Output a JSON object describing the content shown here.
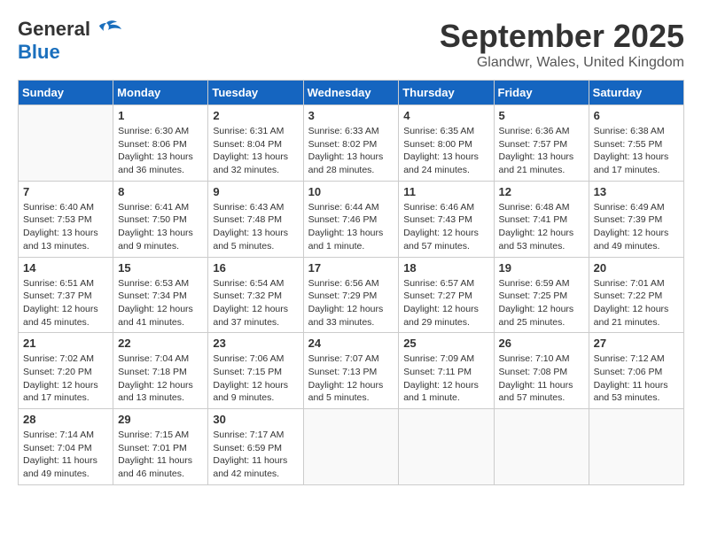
{
  "header": {
    "logo_general": "General",
    "logo_blue": "Blue",
    "month_title": "September 2025",
    "location": "Glandwr, Wales, United Kingdom"
  },
  "weekdays": [
    "Sunday",
    "Monday",
    "Tuesday",
    "Wednesday",
    "Thursday",
    "Friday",
    "Saturday"
  ],
  "weeks": [
    [
      {
        "day": "",
        "info": ""
      },
      {
        "day": "1",
        "info": "Sunrise: 6:30 AM\nSunset: 8:06 PM\nDaylight: 13 hours\nand 36 minutes."
      },
      {
        "day": "2",
        "info": "Sunrise: 6:31 AM\nSunset: 8:04 PM\nDaylight: 13 hours\nand 32 minutes."
      },
      {
        "day": "3",
        "info": "Sunrise: 6:33 AM\nSunset: 8:02 PM\nDaylight: 13 hours\nand 28 minutes."
      },
      {
        "day": "4",
        "info": "Sunrise: 6:35 AM\nSunset: 8:00 PM\nDaylight: 13 hours\nand 24 minutes."
      },
      {
        "day": "5",
        "info": "Sunrise: 6:36 AM\nSunset: 7:57 PM\nDaylight: 13 hours\nand 21 minutes."
      },
      {
        "day": "6",
        "info": "Sunrise: 6:38 AM\nSunset: 7:55 PM\nDaylight: 13 hours\nand 17 minutes."
      }
    ],
    [
      {
        "day": "7",
        "info": "Sunrise: 6:40 AM\nSunset: 7:53 PM\nDaylight: 13 hours\nand 13 minutes."
      },
      {
        "day": "8",
        "info": "Sunrise: 6:41 AM\nSunset: 7:50 PM\nDaylight: 13 hours\nand 9 minutes."
      },
      {
        "day": "9",
        "info": "Sunrise: 6:43 AM\nSunset: 7:48 PM\nDaylight: 13 hours\nand 5 minutes."
      },
      {
        "day": "10",
        "info": "Sunrise: 6:44 AM\nSunset: 7:46 PM\nDaylight: 13 hours\nand 1 minute."
      },
      {
        "day": "11",
        "info": "Sunrise: 6:46 AM\nSunset: 7:43 PM\nDaylight: 12 hours\nand 57 minutes."
      },
      {
        "day": "12",
        "info": "Sunrise: 6:48 AM\nSunset: 7:41 PM\nDaylight: 12 hours\nand 53 minutes."
      },
      {
        "day": "13",
        "info": "Sunrise: 6:49 AM\nSunset: 7:39 PM\nDaylight: 12 hours\nand 49 minutes."
      }
    ],
    [
      {
        "day": "14",
        "info": "Sunrise: 6:51 AM\nSunset: 7:37 PM\nDaylight: 12 hours\nand 45 minutes."
      },
      {
        "day": "15",
        "info": "Sunrise: 6:53 AM\nSunset: 7:34 PM\nDaylight: 12 hours\nand 41 minutes."
      },
      {
        "day": "16",
        "info": "Sunrise: 6:54 AM\nSunset: 7:32 PM\nDaylight: 12 hours\nand 37 minutes."
      },
      {
        "day": "17",
        "info": "Sunrise: 6:56 AM\nSunset: 7:29 PM\nDaylight: 12 hours\nand 33 minutes."
      },
      {
        "day": "18",
        "info": "Sunrise: 6:57 AM\nSunset: 7:27 PM\nDaylight: 12 hours\nand 29 minutes."
      },
      {
        "day": "19",
        "info": "Sunrise: 6:59 AM\nSunset: 7:25 PM\nDaylight: 12 hours\nand 25 minutes."
      },
      {
        "day": "20",
        "info": "Sunrise: 7:01 AM\nSunset: 7:22 PM\nDaylight: 12 hours\nand 21 minutes."
      }
    ],
    [
      {
        "day": "21",
        "info": "Sunrise: 7:02 AM\nSunset: 7:20 PM\nDaylight: 12 hours\nand 17 minutes."
      },
      {
        "day": "22",
        "info": "Sunrise: 7:04 AM\nSunset: 7:18 PM\nDaylight: 12 hours\nand 13 minutes."
      },
      {
        "day": "23",
        "info": "Sunrise: 7:06 AM\nSunset: 7:15 PM\nDaylight: 12 hours\nand 9 minutes."
      },
      {
        "day": "24",
        "info": "Sunrise: 7:07 AM\nSunset: 7:13 PM\nDaylight: 12 hours\nand 5 minutes."
      },
      {
        "day": "25",
        "info": "Sunrise: 7:09 AM\nSunset: 7:11 PM\nDaylight: 12 hours\nand 1 minute."
      },
      {
        "day": "26",
        "info": "Sunrise: 7:10 AM\nSunset: 7:08 PM\nDaylight: 11 hours\nand 57 minutes."
      },
      {
        "day": "27",
        "info": "Sunrise: 7:12 AM\nSunset: 7:06 PM\nDaylight: 11 hours\nand 53 minutes."
      }
    ],
    [
      {
        "day": "28",
        "info": "Sunrise: 7:14 AM\nSunset: 7:04 PM\nDaylight: 11 hours\nand 49 minutes."
      },
      {
        "day": "29",
        "info": "Sunrise: 7:15 AM\nSunset: 7:01 PM\nDaylight: 11 hours\nand 46 minutes."
      },
      {
        "day": "30",
        "info": "Sunrise: 7:17 AM\nSunset: 6:59 PM\nDaylight: 11 hours\nand 42 minutes."
      },
      {
        "day": "",
        "info": ""
      },
      {
        "day": "",
        "info": ""
      },
      {
        "day": "",
        "info": ""
      },
      {
        "day": "",
        "info": ""
      }
    ]
  ]
}
